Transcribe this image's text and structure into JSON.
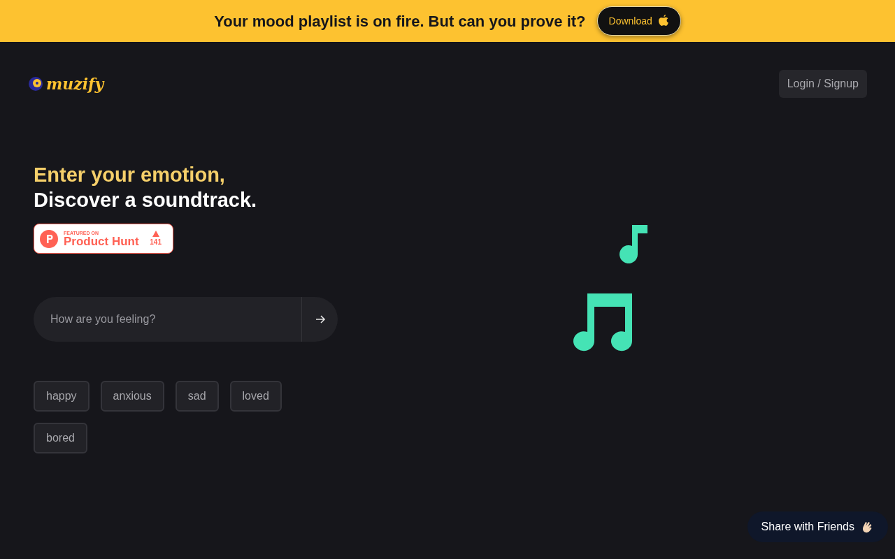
{
  "banner": {
    "text": "Your mood playlist is on fire. But can you prove it?",
    "button": "Download"
  },
  "header": {
    "logo": "muzify",
    "login": "Login / Signup"
  },
  "hero": {
    "line1": "Enter your emotion,",
    "line2": "Discover a soundtrack."
  },
  "badge": {
    "small": "FEATURED ON",
    "name": "Product Hunt",
    "count": "141"
  },
  "search": {
    "placeholder": "How are you feeling?"
  },
  "moods": [
    "happy",
    "anxious",
    "sad",
    "loved",
    "bored"
  ],
  "share": "Share with Friends"
}
